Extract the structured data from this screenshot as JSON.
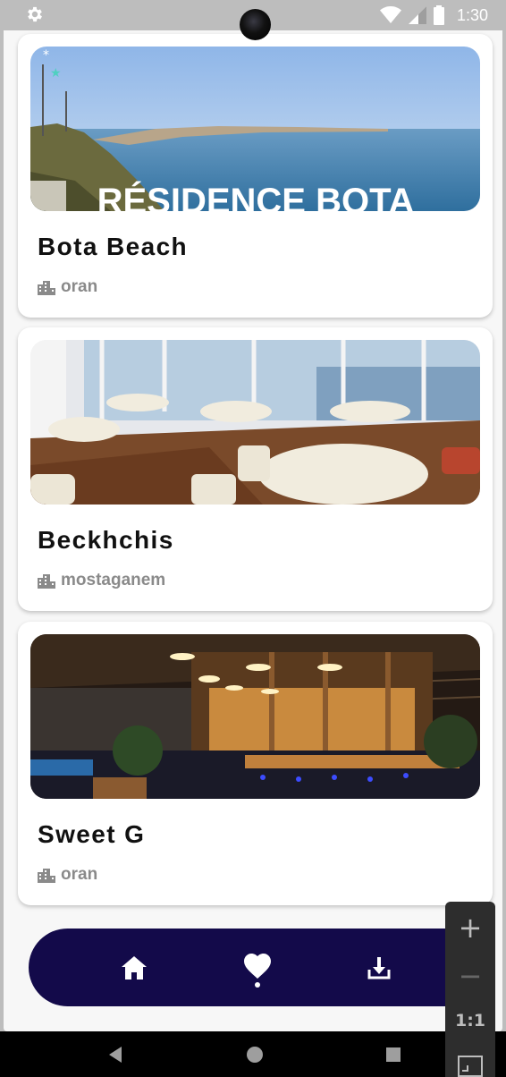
{
  "status_bar": {
    "time": "1:30",
    "icons": [
      "gear-icon",
      "wifi-icon",
      "signal-icon",
      "battery-icon"
    ]
  },
  "cards": [
    {
      "name": "Bota Beach",
      "location": "oran",
      "photo_overlay_text": "RÉSIDENCE BOTA",
      "location_icon": "city-icon"
    },
    {
      "name": "Beckhchis",
      "location": "mostaganem",
      "location_icon": "city-icon"
    },
    {
      "name": "Sweet G",
      "location": "oran",
      "location_icon": "city-icon"
    }
  ],
  "bottom_nav": {
    "items": [
      {
        "icon": "home-icon"
      },
      {
        "icon": "heart-icon",
        "active": true
      },
      {
        "icon": "download-icon"
      }
    ],
    "background": "#130a4a"
  },
  "zoom_controls": {
    "plus": "+",
    "minus": "−",
    "reset": "1:1"
  },
  "colors": {
    "accent": "#130a4a",
    "location_text": "#8a8a8a",
    "status_bar": "#bdbdbd"
  }
}
